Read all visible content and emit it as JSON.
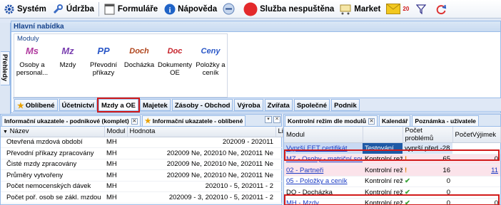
{
  "menu": {
    "items": [
      {
        "label": "Systém",
        "icon": "gear-icon"
      },
      {
        "label": "Údržba",
        "icon": "wrench-icon"
      },
      {
        "label": "Formuláře",
        "icon": "form-icon"
      },
      {
        "label": "Nápověda",
        "icon": "info-icon"
      },
      {
        "label": "",
        "icon": "minus-circle-icon"
      },
      {
        "label": "Služba nespuštěna",
        "icon": "red-circle-icon"
      },
      {
        "label": "Market",
        "icon": "cart-icon"
      },
      {
        "label": "20",
        "icon": "mail-icon"
      },
      {
        "label": "",
        "icon": "filter-icon"
      },
      {
        "label": "",
        "icon": "refresh-icon"
      }
    ],
    "colors": {
      "red": "#e3292b",
      "info": "#1f63c7",
      "mail": "#f2c81f"
    }
  },
  "left_tab": {
    "label": "Přehledy"
  },
  "main_panel": {
    "title": "Hlavní nabídka",
    "group_title": "Moduly",
    "modules": [
      {
        "abbr": "Ms",
        "label": "Osoby a personal...",
        "color": "#b03a9e"
      },
      {
        "abbr": "Mz",
        "label": "Mzdy",
        "color": "#7a3fb0"
      },
      {
        "abbr": "PP",
        "label": "Převodní příkazy",
        "color": "#2a57c7"
      },
      {
        "abbr": "Doch",
        "label": "Docházka",
        "color": "#b0461d"
      },
      {
        "abbr": "Doc",
        "label": "Dokumenty OE",
        "color": "#c6222a"
      },
      {
        "abbr": "Ceny",
        "label": "Položky a ceník",
        "color": "#2a57c7"
      }
    ]
  },
  "tabs": [
    {
      "label": "Oblíbené",
      "icon": "star-icon"
    },
    {
      "label": "Účetnictví"
    },
    {
      "label": "Mzdy a OE",
      "highlighted": true
    },
    {
      "label": "Majetek"
    },
    {
      "label": "Zásoby - Obchod"
    },
    {
      "label": "Výroba"
    },
    {
      "label": "Zvířata"
    },
    {
      "label": "Společné"
    },
    {
      "label": "Podnik"
    }
  ],
  "left_grid": {
    "tabs": [
      "Informační ukazatele - podnikové (komplet)",
      "Informační ukazatele - oblíbené"
    ],
    "columns": [
      "Název",
      "Modul",
      "Hodnota",
      "Li"
    ],
    "rows": [
      {
        "name": "Otevřená mzdová období",
        "module": "MH",
        "value": "202009 - 202011"
      },
      {
        "name": "Převodní příkazy zpracovány",
        "module": "MH",
        "value": "202009 Ne, 202010 Ne, 202011 Ne"
      },
      {
        "name": "Čisté mzdy zpracovány",
        "module": "MH",
        "value": "202009 Ne, 202010 Ne, 202011 Ne"
      },
      {
        "name": "Průměry vytvořeny",
        "module": "MH",
        "value": "202009 Ne, 202010 Ne, 202011 Ne"
      },
      {
        "name": "Počet nemocenských dávek",
        "module": "MH",
        "value": "202010 - 5, 202011 - 2"
      },
      {
        "name": "Počet poř. osob se zákl. mzdou",
        "module": "MH",
        "value": "202009 - 3, 202010 - 5, 202011 - 2"
      }
    ]
  },
  "right_grid": {
    "tabs": [
      "Kontrolní režim dle modulů",
      "Kalendář",
      "Poznámka - uživatele"
    ],
    "columns": [
      "Modul",
      "",
      "Počet problémů",
      "PočetVýjimek"
    ],
    "rows": [
      {
        "module": "Vyprší EET certifikát",
        "mode": "Testování",
        "status": "",
        "problems": "vyprší před -28",
        "exceptions": ""
      },
      {
        "module": "MZ - Osoby - matriční soubor",
        "mode": "Kontrolní režim",
        "status": "warning",
        "problems": "65",
        "exceptions": "0"
      },
      {
        "module": "02 - Partneři",
        "mode": "Kontrolní režim",
        "status": "warning",
        "problems": "16",
        "exceptions": "11"
      },
      {
        "module": "05 - Položky a ceník",
        "mode": "Kontrolní režim",
        "status": "ok",
        "problems": "0",
        "exceptions": ""
      },
      {
        "module": "DO - Docházka",
        "mode": "Kontrolní režim",
        "status": "ok",
        "problems": "0",
        "exceptions": ""
      },
      {
        "module": "MH - Mzdy",
        "mode": "Kontrolní režim",
        "status": "ok",
        "problems": "0",
        "exceptions": "0"
      }
    ]
  }
}
